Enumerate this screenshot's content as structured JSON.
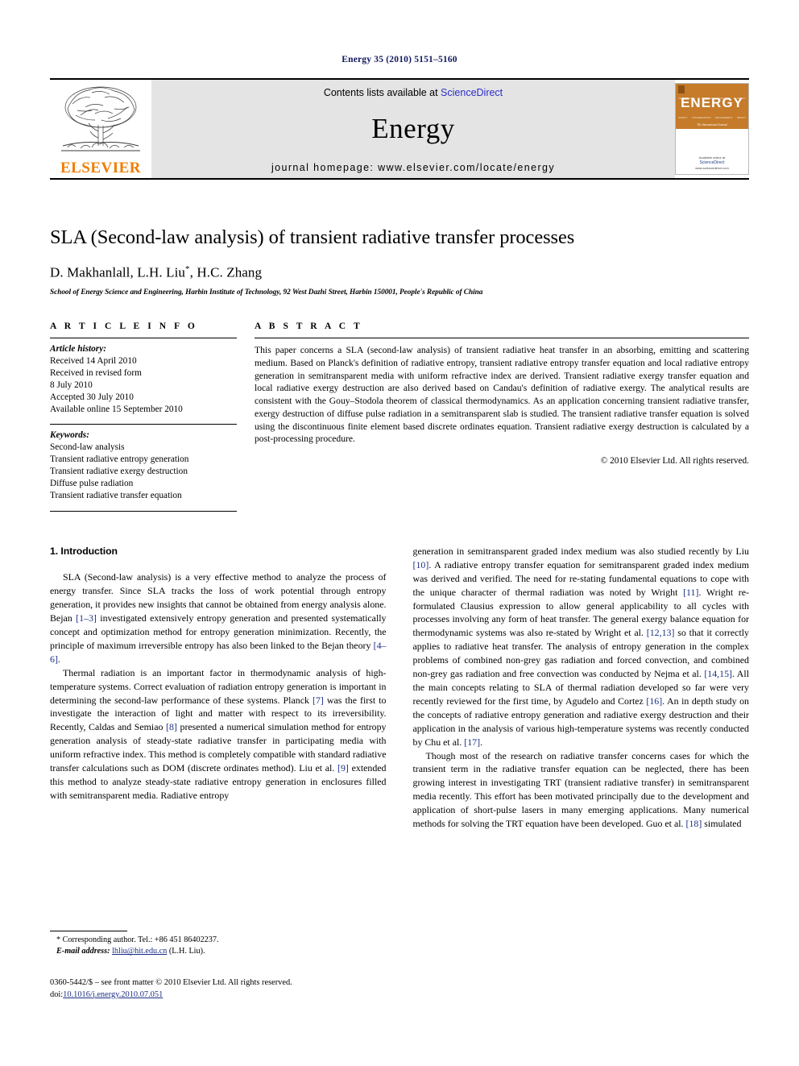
{
  "running_head": "Energy 35 (2010) 5151–5160",
  "masthead": {
    "publisher_name": "ELSEVIER",
    "contents_prefix": "Contents lists available at ",
    "contents_link": "ScienceDirect",
    "journal_name": "Energy",
    "homepage": "journal homepage: www.elsevier.com/locate/energy",
    "cover": {
      "title": "ENERGY",
      "subtitle": "The International Journal",
      "row_labels": [
        "TECHNOLOGY",
        "SCIENCE",
        "PLANNING",
        "POLICY"
      ],
      "row_labels2": [
        "SUPPLY",
        "CONSERVATION",
        "MANAGEMENT",
        "IMPACT"
      ],
      "bottom_note": "Available online at",
      "bottom_logo": "ScienceDirect",
      "bottom_url": "www.sciencedirect.com"
    }
  },
  "article": {
    "title": "SLA (Second-law analysis) of transient radiative transfer processes",
    "authors": "D. Makhanlall, L.H. Liu",
    "corresponding_marker": "*",
    "authors_tail": ", H.C. Zhang",
    "affiliation": "School of Energy Science and Engineering, Harbin Institute of Technology, 92 West Dazhi Street, Harbin 150001, People's Republic of China"
  },
  "info": {
    "heading": "A R T I C L E  I N F O",
    "history_label": "Article history:",
    "history": [
      "Received 14 April 2010",
      "Received in revised form",
      "8 July 2010",
      "Accepted 30 July 2010",
      "Available online 15 September 2010"
    ],
    "keywords_label": "Keywords:",
    "keywords": [
      "Second-law analysis",
      "Transient radiative entropy generation",
      "Transient radiative exergy destruction",
      "Diffuse pulse radiation",
      "Transient radiative transfer equation"
    ]
  },
  "abstract": {
    "heading": "A B S T R A C T",
    "text": "This paper concerns a SLA (second-law analysis) of transient radiative heat transfer in an absorbing, emitting and scattering medium. Based on Planck's definition of radiative entropy, transient radiative entropy transfer equation and local radiative entropy generation in semitransparent media with uniform refractive index are derived. Transient radiative exergy transfer equation and local radiative exergy destruction are also derived based on Candau's definition of radiative exergy. The analytical results are consistent with the Gouy–Stodola theorem of classical thermodynamics. As an application concerning transient radiative transfer, exergy destruction of diffuse pulse radiation in a semitransparent slab is studied. The transient radiative transfer equation is solved using the discontinuous finite element based discrete ordinates equation. Transient radiative exergy destruction is calculated by a post-processing procedure.",
    "copyright": "© 2010 Elsevier Ltd. All rights reserved."
  },
  "body": {
    "section_number_title": "1. Introduction",
    "left_paragraphs": [
      {
        "segments": [
          {
            "t": "SLA (Second-law analysis) is a very effective method to analyze the process of energy transfer. Since SLA tracks the loss of work potential through entropy generation, it provides new insights that cannot be obtained from energy analysis alone. Bejan ",
            "ref": false
          },
          {
            "t": "[1–3]",
            "ref": true
          },
          {
            "t": " investigated extensively entropy generation and presented systematically concept and optimization method for entropy generation minimization. Recently, the principle of maximum irreversible entropy has also been linked to the Bejan theory ",
            "ref": false
          },
          {
            "t": "[4–6]",
            "ref": true
          },
          {
            "t": ".",
            "ref": false
          }
        ]
      },
      {
        "segments": [
          {
            "t": "Thermal radiation is an important factor in thermodynamic analysis of high-temperature systems. Correct evaluation of radiation entropy generation is important in determining the second-law performance of these systems. Planck ",
            "ref": false
          },
          {
            "t": "[7]",
            "ref": true
          },
          {
            "t": " was the first to investigate the interaction of light and matter with respect to its irreversibility. Recently, Caldas and Semiao ",
            "ref": false
          },
          {
            "t": "[8]",
            "ref": true
          },
          {
            "t": " presented a numerical simulation method for entropy generation analysis of steady-state radiative transfer in participating media with uniform refractive index. This method is completely compatible with standard radiative transfer calculations such as DOM (discrete ordinates method). Liu et al. ",
            "ref": false
          },
          {
            "t": "[9]",
            "ref": true
          },
          {
            "t": " extended this method to analyze steady-state radiative entropy generation in enclosures filled with semitransparent media. Radiative entropy",
            "ref": false
          }
        ]
      }
    ],
    "right_paragraphs": [
      {
        "continues": true,
        "segments": [
          {
            "t": "generation in semitransparent graded index medium was also studied recently by Liu ",
            "ref": false
          },
          {
            "t": "[10]",
            "ref": true
          },
          {
            "t": ". A radiative entropy transfer equation for semitransparent graded index medium was derived and verified. The need for re-stating fundamental equations to cope with the unique character of thermal radiation was noted by Wright ",
            "ref": false
          },
          {
            "t": "[11]",
            "ref": true
          },
          {
            "t": ". Wright re-formulated Clausius expression to allow general applicability to all cycles with processes involving any form of heat transfer. The general exergy balance equation for thermodynamic systems was also re-stated by Wright et al. ",
            "ref": false
          },
          {
            "t": "[12,13]",
            "ref": true
          },
          {
            "t": " so that it correctly applies to radiative heat transfer. The analysis of entropy generation in the complex problems of combined non-grey gas radiation and forced convection, and combined non-grey gas radiation and free convection was conducted by Nejma et al. ",
            "ref": false
          },
          {
            "t": "[14,15]",
            "ref": true
          },
          {
            "t": ". All the main concepts relating to SLA of thermal radiation developed so far were very recently reviewed for the first time, by Agudelo and Cortez ",
            "ref": false
          },
          {
            "t": "[16]",
            "ref": true
          },
          {
            "t": ". An in depth study on the concepts of radiative entropy generation and radiative exergy destruction and their application in the analysis of various high-temperature systems was recently conducted by Chu et al. ",
            "ref": false
          },
          {
            "t": "[17]",
            "ref": true
          },
          {
            "t": ".",
            "ref": false
          }
        ]
      },
      {
        "continues": false,
        "segments": [
          {
            "t": "Though most of the research on radiative transfer concerns cases for which the transient term in the radiative transfer equation can be neglected, there has been growing interest in investigating TRT (transient radiative transfer) in semitransparent media recently. This effort has been motivated principally due to the development and application of short-pulse lasers in many emerging applications. Many numerical methods for solving the TRT equation have been developed. Guo et al. ",
            "ref": false
          },
          {
            "t": "[18]",
            "ref": true
          },
          {
            "t": " simulated",
            "ref": false
          }
        ]
      }
    ]
  },
  "footnote": {
    "line1": "* Corresponding author. Tel.: +86 451 86402237.",
    "email_label": "E-mail address:",
    "email": "lhliu@hit.edu.cn",
    "email_suffix": "(L.H. Liu)."
  },
  "footer": {
    "line1": "0360-5442/$ – see front matter © 2010 Elsevier Ltd. All rights reserved.",
    "doi_label": "doi:",
    "doi": "10.1016/j.energy.2010.07.051"
  },
  "colors": {
    "running_head": "#11185e",
    "link_blue": "#2c2ccd",
    "ref_blue": "#1c2f86",
    "elsevier_orange": "#f07c00",
    "masthead_grey": "#e4e4e4",
    "cover_orange": "#c57b2a"
  }
}
